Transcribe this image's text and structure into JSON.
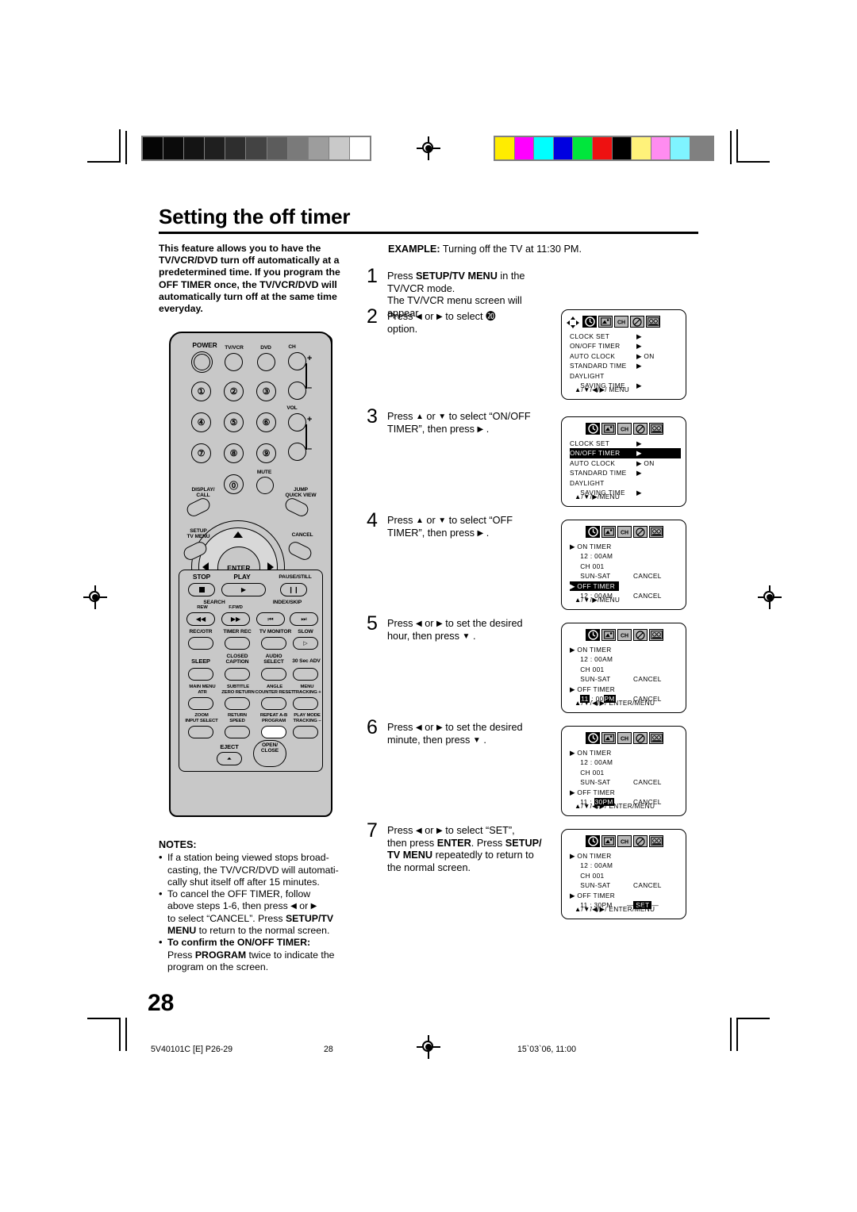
{
  "page": {
    "title": "Setting the off timer",
    "number": "28",
    "footer": {
      "left": "5V40101C [E] P26-29",
      "center": "28",
      "right": "15`03`06, 11:00"
    },
    "registration": {
      "grayscale": [
        "#050505",
        "#0b0b0b",
        "#141414",
        "#1f1f1f",
        "#2e2e2e",
        "#434343",
        "#5c5c5c",
        "#7a7a7a",
        "#9d9d9d",
        "#c9c9c9",
        "#ffffff"
      ],
      "colors": [
        "#ffec00",
        "#ff00ff",
        "#00ffff",
        "#0000e0",
        "#00e63c",
        "#ee1111",
        "#000000",
        "#fff27a",
        "#ff8cf0",
        "#7ff4ff",
        "#808080"
      ]
    }
  },
  "intro": {
    "text": "This feature allows you to have the TV/VCR/DVD turn off automatically at a predetermined time. If you program the OFF TIMER once, the TV/VCR/DVD will automatically turn off at the same time everyday."
  },
  "example": {
    "label": "EXAMPLE:",
    "text": " Turning off the TV at 11:30 PM."
  },
  "steps": [
    {
      "num": "1",
      "html": "Press <b>SETUP/TV MENU</b> in the TV/VCR mode.<br>The TV/VCR menu screen will appear."
    },
    {
      "num": "2",
      "html": "Press <span class=\"tri\">◀</span> or <span class=\"tri\">▶</span> to select ⓴<br>option."
    },
    {
      "num": "3",
      "html": "Press <span class=\"tri\">▲</span> or <span class=\"tri\">▼</span> to select “ON/OFF<br>TIMER”, then press <span class=\"tri\">▶</span> ."
    },
    {
      "num": "4",
      "html": "Press <span class=\"tri\">▲</span> or <span class=\"tri\">▼</span> to select “OFF<br>TIMER”, then press <span class=\"tri\">▶</span> ."
    },
    {
      "num": "5",
      "html": "Press <span class=\"tri\">◀</span> or <span class=\"tri\">▶</span> to set the desired<br>hour, then press <span class=\"tri\">▼</span> ."
    },
    {
      "num": "6",
      "html": "Press <span class=\"tri\">◀</span> or <span class=\"tri\">▶</span> to set the desired<br>minute, then press <span class=\"tri\">▼</span> ."
    },
    {
      "num": "7",
      "html": "Press <span class=\"tri\">◀</span> or <span class=\"tri\">▶</span> to select “SET”,<br>then press <b>ENTER</b>. Press <b>SETUP/</b><br><b>TV MENU</b> repeatedly to return to<br>the normal screen."
    }
  ],
  "notes": {
    "heading": "NOTES:",
    "items": [
      "If a station being viewed stops broad-casting, the TV/VCR/DVD will automatically shut itself off after 15 minutes.",
      "To cancel the OFF TIMER, follow above steps 1-6, then press ◀ or ▶ to select “CANCEL”. Press SETUP/TV MENU to return to the normal screen.",
      "To confirm the ON/OFF TIMER: Press PROGRAM twice to indicate the program on the screen."
    ]
  },
  "osd_menus": [
    {
      "id": "clock-menu",
      "has_dpad": true,
      "selected_icon": 0,
      "icons": [
        "clock-icon",
        "picture-icon",
        "channel-icon",
        "prohibit-icon",
        "vcr-icon"
      ],
      "rows": [
        {
          "label": "CLOCK  SET",
          "right": "▶",
          "rightx": 84,
          "highlight": false
        },
        {
          "label": "ON/OFF  TIMER",
          "right": "▶",
          "rightx": 84,
          "highlight": false
        },
        {
          "label": "AUTO  CLOCK",
          "right": "▶ ON",
          "rightx": 84,
          "highlight": false
        },
        {
          "label": "STANDARD  TIME",
          "right": "▶",
          "rightx": 84,
          "highlight": false
        },
        {
          "label": "DAYLIGHT",
          "right": "",
          "rightx": 84,
          "highlight": false
        },
        {
          "label": "     SAVING  TIME",
          "right": "▶",
          "rightx": 84,
          "highlight": false
        }
      ],
      "footer": "▲/▼/◀/▶/ MENU"
    },
    {
      "id": "onoff-timer-selected",
      "has_dpad": false,
      "selected_icon": 0,
      "icons": [
        "clock-icon",
        "picture-icon",
        "channel-icon",
        "prohibit-icon",
        "vcr-icon"
      ],
      "rows": [
        {
          "label": "CLOCK  SET",
          "right": "▶",
          "rightx": 84,
          "highlight": false
        },
        {
          "label": "ON/OFF  TIMER",
          "right": "▶",
          "rightx": 84,
          "highlight": true
        },
        {
          "label": "AUTO  CLOCK",
          "right": "▶ ON",
          "rightx": 84,
          "highlight": false
        },
        {
          "label": "STANDARD  TIME",
          "right": "▶",
          "rightx": 84,
          "highlight": false
        },
        {
          "label": "DAYLIGHT",
          "right": "",
          "rightx": 84,
          "highlight": false
        },
        {
          "label": "     SAVING  TIME",
          "right": "▶",
          "rightx": 84,
          "highlight": false
        }
      ],
      "footer": "▲/▼/▶/MENU"
    },
    {
      "id": "off-timer-selected",
      "has_dpad": false,
      "selected_icon": 0,
      "icons": [
        "clock-icon",
        "picture-icon",
        "channel-icon",
        "prohibit-icon",
        "vcr-icon"
      ],
      "rows": [
        {
          "label": "▶  ON TIMER",
          "right": "",
          "rightx": 84,
          "highlight": false
        },
        {
          "label": "     12 : 00AM",
          "right": "",
          "rightx": 84,
          "highlight": false
        },
        {
          "label": "     CH 001",
          "right": "",
          "rightx": 84,
          "highlight": false
        },
        {
          "label": "     SUN-SAT",
          "right": "CANCEL",
          "rightx": 80,
          "highlight": false
        },
        {
          "label": "▶  OFF TIMER",
          "right": "",
          "rightx": 84,
          "highlight": true,
          "hlwidth": 62
        },
        {
          "label": "     12 : 00AM",
          "right": "CANCEL",
          "rightx": 80,
          "highlight": false
        }
      ],
      "footer": "▲/▼/▶/MENU"
    },
    {
      "id": "off-timer-hour",
      "has_dpad": false,
      "selected_icon": 0,
      "icons": [
        "clock-icon",
        "picture-icon",
        "channel-icon",
        "prohibit-icon",
        "vcr-icon"
      ],
      "rows": [
        {
          "label": "▶  ON TIMER",
          "right": "",
          "rightx": 84,
          "highlight": false
        },
        {
          "label": "     12 : 00AM",
          "right": "",
          "rightx": 84,
          "highlight": false
        },
        {
          "label": "     CH 001",
          "right": "",
          "rightx": 84,
          "highlight": false
        },
        {
          "label": "     SUN-SAT",
          "right": "CANCEL",
          "rightx": 80,
          "highlight": false
        },
        {
          "label": "▶  OFF TIMER",
          "right": "",
          "rightx": 84,
          "highlight": false
        },
        {
          "label": "__TIME_HOUR__",
          "right": "CANCEL",
          "rightx": 80,
          "highlight": false,
          "time": {
            "hour": "11",
            "minute": "00",
            "ampm": "PM",
            "hour_inv": true,
            "min_inv": false,
            "ampm_inv": true
          }
        }
      ],
      "footer": "▲/▼/◀/▶/ ENTER/MENU"
    },
    {
      "id": "off-timer-minute",
      "has_dpad": false,
      "selected_icon": 0,
      "icons": [
        "clock-icon",
        "picture-icon",
        "channel-icon",
        "prohibit-icon",
        "vcr-icon"
      ],
      "rows": [
        {
          "label": "▶  ON TIMER",
          "right": "",
          "rightx": 84,
          "highlight": false
        },
        {
          "label": "     12 : 00AM",
          "right": "",
          "rightx": 84,
          "highlight": false
        },
        {
          "label": "     CH 001",
          "right": "",
          "rightx": 84,
          "highlight": false
        },
        {
          "label": "     SUN-SAT",
          "right": "CANCEL",
          "rightx": 80,
          "highlight": false
        },
        {
          "label": "▶  OFF TIMER",
          "right": "",
          "rightx": 84,
          "highlight": false
        },
        {
          "label": "__TIME_MIN__",
          "right": "CANCEL",
          "rightx": 80,
          "highlight": false,
          "time": {
            "hour": "11",
            "minute": "30",
            "ampm": "PM",
            "hour_inv": false,
            "min_inv": true,
            "ampm_inv": true
          }
        }
      ],
      "footer": "▲/▼/◀/▶/ ENTER/MENU"
    },
    {
      "id": "off-timer-set",
      "has_dpad": false,
      "selected_icon": 0,
      "icons": [
        "clock-icon",
        "picture-icon",
        "channel-icon",
        "prohibit-icon",
        "vcr-icon"
      ],
      "rows": [
        {
          "label": "▶  ON TIMER",
          "right": "",
          "rightx": 84,
          "highlight": false
        },
        {
          "label": "     12 : 00AM",
          "right": "",
          "rightx": 84,
          "highlight": false
        },
        {
          "label": "     CH 001",
          "right": "",
          "rightx": 84,
          "highlight": false
        },
        {
          "label": "     SUN-SAT",
          "right": "CANCEL",
          "rightx": 80,
          "highlight": false
        },
        {
          "label": "▶  OFF TIMER",
          "right": "",
          "rightx": 84,
          "highlight": false
        },
        {
          "label": "     11 : 30PM",
          "right": "SET",
          "rightx": 82,
          "highlight": false,
          "right_invbox": true
        }
      ],
      "footer": "▲/▼/◀/▶/ ENTER/MENU"
    }
  ],
  "remote": {
    "name": "remote-control-diagram",
    "labels": {
      "power": "POWER",
      "tvvcr": "TV/VCR",
      "dvd": "DVD",
      "ch": "CH",
      "vol": "VOL",
      "plus1": "+",
      "minus1": "–",
      "plus2": "+",
      "minus2": "–",
      "n1": "①",
      "n2": "②",
      "n3": "③",
      "n4": "④",
      "n5": "⑤",
      "n6": "⑥",
      "n7": "⑦",
      "n8": "⑧",
      "n9": "⑨",
      "n0": "⓪",
      "mute": "MUTE",
      "display_call": "DISPLAY/\nCALL",
      "jump_quickview": "JUMP\nQUICK VIEW",
      "setup_tvmenu": "SETUP\nTV MENU",
      "cancel": "CANCEL",
      "enter": "ENTER",
      "stop": "STOP",
      "play": "PLAY",
      "pause_still": "PAUSE/STILL",
      "search": "SEARCH",
      "rew": "REW",
      "ffwd": "F.FWD",
      "index_skip": "INDEX/SKIP",
      "rec_otr": "REC/OTR",
      "timer_rec": "TIMER REC",
      "tv_monitor": "TV MONITOR",
      "slow": "SLOW",
      "sleep": "SLEEP",
      "closed_caption": "CLOSED\nCAPTION",
      "audio_select": "AUDIO\nSELECT",
      "sec_adv": "30 Sec ADV",
      "main_menu_atr": "MAIN MENU\nATR",
      "subtitle_zeroreturn": "SUBTITLE\nZERO RETURN",
      "angle_counterreset": "ANGLE\nCOUNTER RESET",
      "menu_tracking_plus": "MENU\nTRACKING +",
      "zoom_inputselect": "ZOOM\nINPUT SELECT",
      "return_speed": "RETURN\nSPEED",
      "repeat_program": "REPEAT A-B\nPROGRAM",
      "playmode_tracking_minus": "PLAY MODE\nTRACKING –",
      "eject": "EJECT",
      "open_close": "OPEN/\nCLOSE"
    }
  }
}
